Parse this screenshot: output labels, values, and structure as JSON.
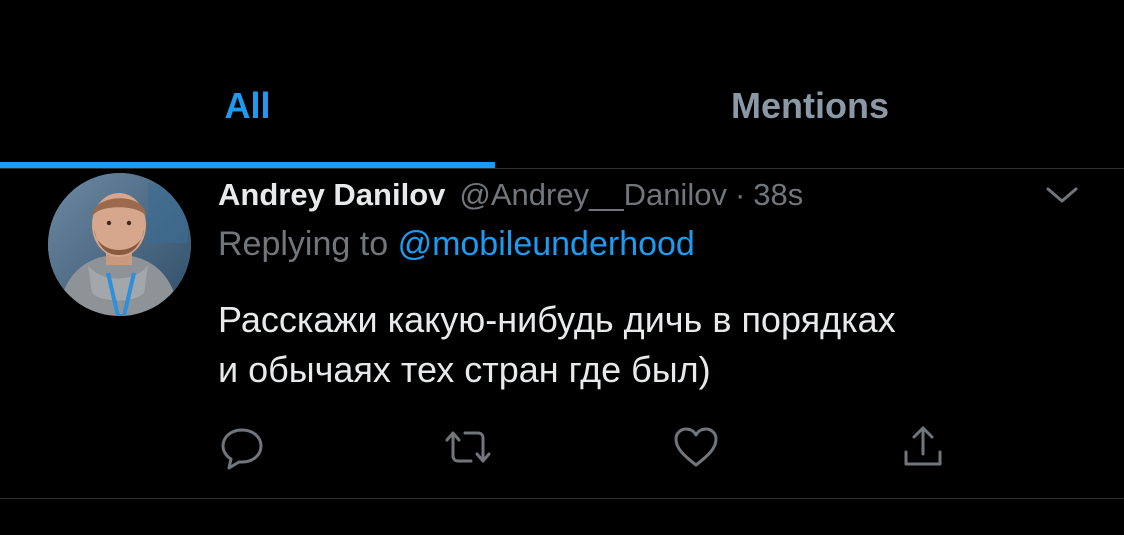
{
  "tabs": [
    {
      "label": "All",
      "active": true
    },
    {
      "label": "Mentions",
      "active": false
    }
  ],
  "colors": {
    "accent": "#1d9bf0",
    "muted": "#71767b",
    "text": "#e7e9ea",
    "background": "#000000"
  },
  "tweet": {
    "display_name": "Andrey Danilov",
    "handle": "@Andrey__Danilov",
    "separator": "·",
    "time": "38s",
    "reply_prefix": "Replying to",
    "reply_mention": "@mobileunderhood",
    "text_lines": [
      "Расскажи какую-нибудь дичь в порядках",
      "и обычаях тех стран где был)"
    ],
    "icons": {
      "avatar": "avatar-photo",
      "menu": "chevron-down-icon",
      "reply": "reply-icon",
      "retweet": "retweet-icon",
      "like": "heart-icon",
      "share": "share-icon"
    }
  }
}
